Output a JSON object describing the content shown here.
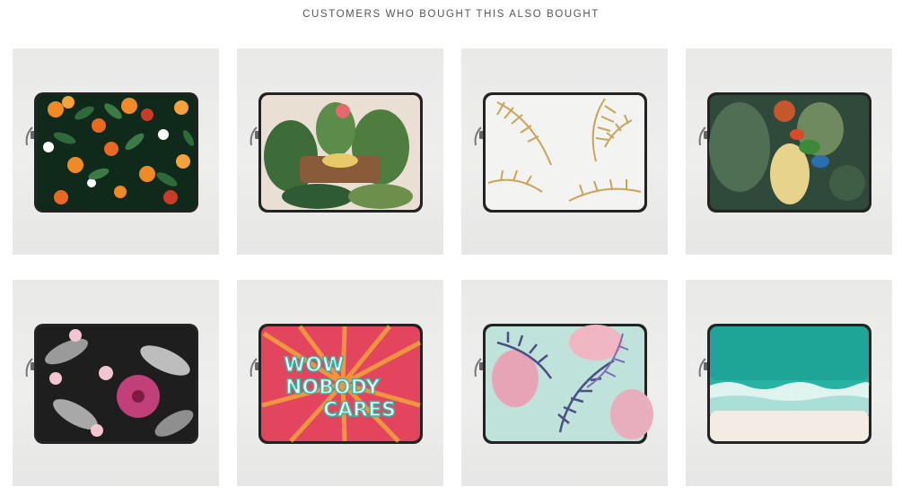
{
  "section": {
    "title": "CUSTOMERS WHO BOUGHT THIS ALSO BOUGHT"
  },
  "products": [
    {
      "design": "tropical-orange-fruit-floral",
      "colors": {
        "bg": "#0f2a1a",
        "accent": "#f08a24"
      }
    },
    {
      "design": "jungle-plants-collage",
      "colors": {
        "bg": "#e9dfd3",
        "accent": "#3d6b3a"
      }
    },
    {
      "design": "gold-palm-leaves",
      "colors": {
        "bg": "#f3f3f1",
        "accent": "#c9a45a"
      }
    },
    {
      "design": "tropical-parrots-collage",
      "colors": {
        "bg": "#2f4a3a",
        "accent": "#c6562b"
      }
    },
    {
      "design": "hibiscus-monochrome-leaves",
      "colors": {
        "bg": "#1e1e1e",
        "accent": "#c2407a"
      }
    },
    {
      "design": "wow-nobody-cares",
      "text_lines": [
        "WOW",
        "NOBODY",
        "CARES"
      ],
      "colors": {
        "bg": "#e3455e",
        "accent": "#2fb8a8"
      }
    },
    {
      "design": "pastel-palm-pink-leaves",
      "colors": {
        "bg": "#bfe3da",
        "accent": "#e7a4b6"
      }
    },
    {
      "design": "turquoise-beach-waves",
      "colors": {
        "bg": "#27b3a4",
        "accent": "#f2ece4"
      }
    }
  ]
}
